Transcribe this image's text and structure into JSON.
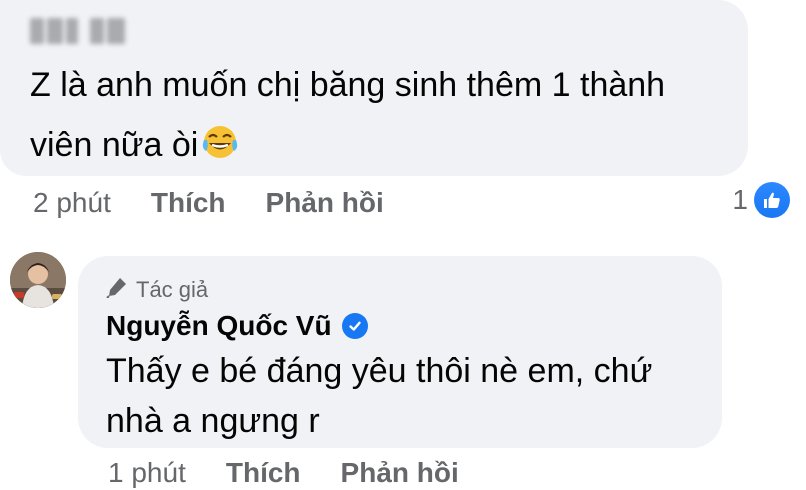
{
  "comment1": {
    "text": "Z là anh muốn chị băng sinh thêm 1 thành viên nữa òi",
    "emoji": "laughing-tears-emoji",
    "time": "2 phút",
    "like_label": "Thích",
    "reply_label": "Phản hồi",
    "reaction_count": "1",
    "reaction_icon": "like-icon"
  },
  "comment2": {
    "author_badge": "Tác giả",
    "author_name": "Nguyễn Quốc Vũ",
    "verified_icon": "verified-check-icon",
    "text": "Thấy e bé đáng yêu thôi nè em, chứ nhà a ngưng r",
    "time": "1 phút",
    "like_label": "Thích",
    "reply_label": "Phản hồi"
  },
  "colors": {
    "bubble": "#f0f2f5",
    "secondary_text": "#65676b",
    "primary_text": "#050505",
    "accent_blue": "#1877f2"
  }
}
